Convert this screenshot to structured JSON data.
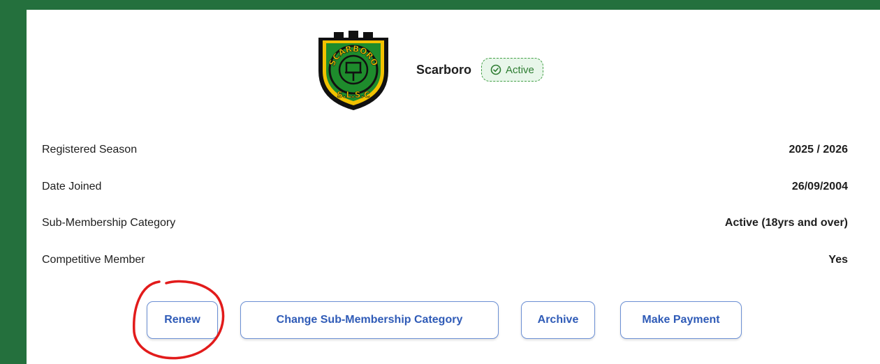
{
  "club": {
    "name": "Scarboro",
    "logo_text_top": "SCARBORO",
    "logo_text_bottom": "S.L.S.C"
  },
  "status": {
    "label": "Active",
    "color": "#2e7d32"
  },
  "details": [
    {
      "label": "Registered Season",
      "value": "2025 / 2026"
    },
    {
      "label": "Date Joined",
      "value": "26/09/2004"
    },
    {
      "label": "Sub-Membership Category",
      "value": "Active (18yrs and over)"
    },
    {
      "label": "Competitive Member",
      "value": "Yes"
    }
  ],
  "actions": {
    "renew": "Renew",
    "change_category": "Change Sub-Membership Category",
    "archive": "Archive",
    "make_payment": "Make Payment"
  },
  "colors": {
    "frame": "#24703d",
    "button_text": "#2f5bb7",
    "annotation": "#e21b1b"
  }
}
